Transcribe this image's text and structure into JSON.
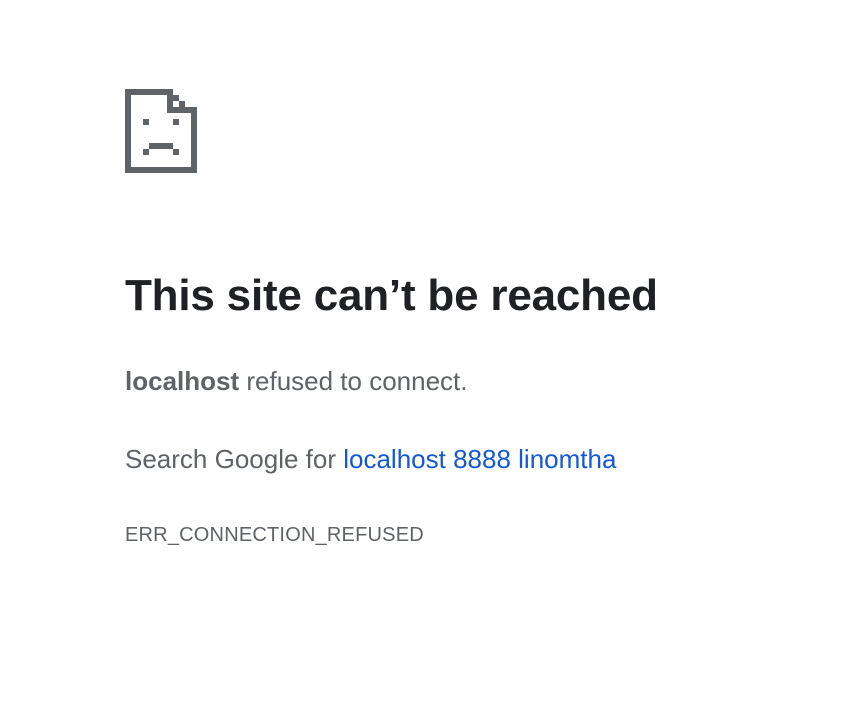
{
  "error": {
    "icon": "sad-page-icon",
    "heading": "This site can’t be reached",
    "host": "localhost",
    "summary_rest": " refused to connect.",
    "suggestion_prefix": "Search Google for ",
    "search_link": "localhost 8888 linomtha",
    "code": "ERR_CONNECTION_REFUSED"
  },
  "colors": {
    "heading": "#202124",
    "body_text": "#5f6368",
    "link": "#1558d6",
    "icon": "#5f6368",
    "background": "#ffffff"
  }
}
